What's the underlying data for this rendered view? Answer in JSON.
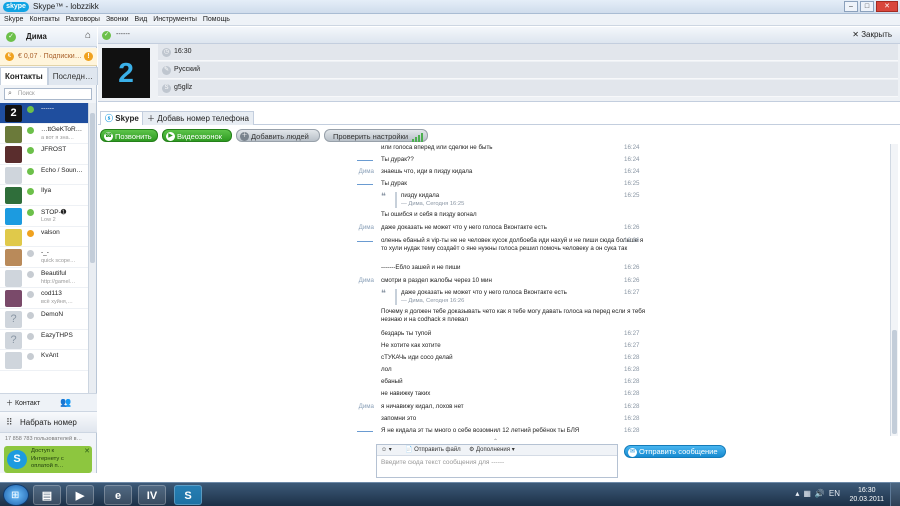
{
  "window": {
    "title": "Skype™ - lobzzikk",
    "logo_text": "S"
  },
  "menu": [
    "Skype",
    "Контакты",
    "Разговоры",
    "Звонки",
    "Вид",
    "Инструменты",
    "Помощь"
  ],
  "user": {
    "name": "Дима"
  },
  "credit": {
    "text": "€ 0,07 · Подписки…"
  },
  "left_tabs": [
    "Контакты",
    "Последн…"
  ],
  "search": {
    "placeholder": "Поиск"
  },
  "contacts": [
    {
      "name": "------",
      "mood": "",
      "status": "online"
    },
    {
      "name": "…ttGeKToR…",
      "mood": "а вот я зна…",
      "status": "online"
    },
    {
      "name": "JFROST",
      "mood": "",
      "status": "online"
    },
    {
      "name": "Echo / Soun…",
      "mood": "",
      "status": "online"
    },
    {
      "name": "Ilya",
      "mood": "",
      "status": "online"
    },
    {
      "name": "STOP-➊",
      "mood": "Low 2",
      "status": "online"
    },
    {
      "name": "valson",
      "mood": "",
      "status": "away"
    },
    {
      "name": "-_-",
      "mood": "quick scope…",
      "status": "offline"
    },
    {
      "name": "Beautiful",
      "mood": "http://gamel…",
      "status": "offline"
    },
    {
      "name": "cod113",
      "mood": "всё хуйня,…",
      "status": "offline"
    },
    {
      "name": "DemoN",
      "mood": "",
      "status": "offline"
    },
    {
      "name": "EazyTHPS",
      "mood": "",
      "status": "offline"
    },
    {
      "name": "KvAnt",
      "mood": "",
      "status": "offline"
    }
  ],
  "left_bottom": {
    "add_contact": "Контакт",
    "dial": "Набрать номер",
    "online_count": "17 858 783 пользователей в…",
    "promo": "Доступ к Интернету с оплатой п…"
  },
  "chat_header": {
    "name": "------",
    "close_label": "Закрыть"
  },
  "profile": {
    "picture_text": "2",
    "fields": [
      "16:30",
      "Русский",
      "g5gllz"
    ]
  },
  "profile_tabs": [
    "Skype",
    "Добавь номер телефона"
  ],
  "actions": {
    "call": "Позвонить",
    "video": "Видеозвонок",
    "add_people": "Добавить людей",
    "check_settings": "Проверить настройки"
  },
  "messages": [
    {
      "sender": "",
      "text": "или голоса вперед или сделки не быть",
      "time": "16:24",
      "dash": false
    },
    {
      "sender": "",
      "text": "Ты дурак??",
      "time": "16:24",
      "dash": true
    },
    {
      "sender": "Дима",
      "text": "знаешь что, иди в пизду кидала",
      "time": "16:24",
      "dash": false
    },
    {
      "sender": "",
      "text": "Ты дурак",
      "time": "16:25",
      "dash": true
    },
    {
      "sender": "",
      "text": "",
      "quote": "пизду кидала",
      "quote_meta": "— Дима, Сегодня 16:25",
      "time": "16:25",
      "dash": false
    },
    {
      "sender": "",
      "text": "Ты ошибся и себя в пизду вогнал",
      "time": "",
      "dash": false
    },
    {
      "sender": "Дима",
      "text": "даже доказать не может что у него голоса Вконтакте есть",
      "time": "16:26",
      "dash": false
    },
    {
      "sender": "",
      "text": "оленнь ебаный я vip-ты не не человек кусок долбоеба иди нахуй и не пиши сюда больше я то хули нудак тему создаёт о яне нужны голоса решил помочь человеку а он сука так",
      "time": "16:26",
      "dash": true
    },
    {
      "sender": "",
      "text": "-------Ебло зашей и не пиши",
      "time": "16:26",
      "dash": false
    },
    {
      "sender": "Дима",
      "text": "смотри в раздел жалобы через 10 мин",
      "time": "16:26",
      "dash": false
    },
    {
      "sender": "",
      "text": "",
      "quote": "даже доказать не может что у него голоса Вконтакте есть",
      "quote_meta": "— Дима, Сегодня 16:26",
      "time": "16:27",
      "dash": false
    },
    {
      "sender": "",
      "text": "Почему я должен тебе доказывать чето как я тебе могу давать голоса на перед если я тебя незнаю и на codhack я плевал",
      "time": "",
      "dash": false
    },
    {
      "sender": "",
      "text": "бездарь ты тупой",
      "time": "16:27",
      "dash": false
    },
    {
      "sender": "",
      "text": "Не хотите как хотите",
      "time": "16:27",
      "dash": false
    },
    {
      "sender": "",
      "text": "сТУКАЧь иди сосо делай",
      "time": "16:28",
      "dash": false
    },
    {
      "sender": "",
      "text": "лол",
      "time": "16:28",
      "dash": false
    },
    {
      "sender": "",
      "text": "ебаный",
      "time": "16:28",
      "dash": false
    },
    {
      "sender": "",
      "text": "не навижку таких",
      "time": "16:28",
      "dash": false
    },
    {
      "sender": "Дима",
      "text": "я ничавижу кидал, лохов нет",
      "time": "16:28",
      "dash": false
    },
    {
      "sender": "",
      "text": "запомни это",
      "time": "16:28",
      "dash": false
    },
    {
      "sender": "",
      "text": "Я не кидала эт ты много о себе возомнил 12 летний ребёнок ты БЛЯ",
      "time": "16:28",
      "dash": true
    }
  ],
  "composer": {
    "send_file": "Отправить файл",
    "extras": "Дополнения",
    "placeholder": "Введите сюда текст сообщения для ------",
    "send": "Отправить сообщение"
  },
  "taskbar": {
    "time": "16:30",
    "date": "20.03.2011"
  }
}
